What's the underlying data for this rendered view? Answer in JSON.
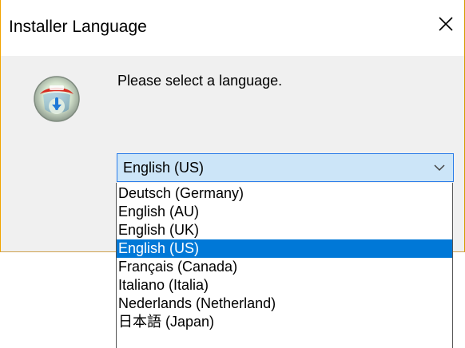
{
  "window": {
    "title": "Installer Language",
    "prompt": "Please select a language."
  },
  "language_select": {
    "selected_value": "English (US)"
  },
  "dropdown": {
    "options": [
      {
        "label": "Deutsch (Germany)",
        "selected": false
      },
      {
        "label": "English (AU)",
        "selected": false
      },
      {
        "label": "English (UK)",
        "selected": false
      },
      {
        "label": "English (US)",
        "selected": true
      },
      {
        "label": "Français (Canada)",
        "selected": false
      },
      {
        "label": "Italiano (Italia)",
        "selected": false
      },
      {
        "label": "Nederlands (Netherland)",
        "selected": false
      },
      {
        "label": "日本語 (Japan)",
        "selected": false
      }
    ]
  },
  "icons": {
    "close": "close-icon",
    "app": "installer-icon",
    "dropdown": "chevron-down-icon"
  },
  "colors": {
    "dialog_background": "#f0f0f0",
    "select_background": "#cce5f8",
    "select_border": "#2b7de9",
    "selected_option": "#0078d7",
    "window_border": "#f2a400"
  }
}
